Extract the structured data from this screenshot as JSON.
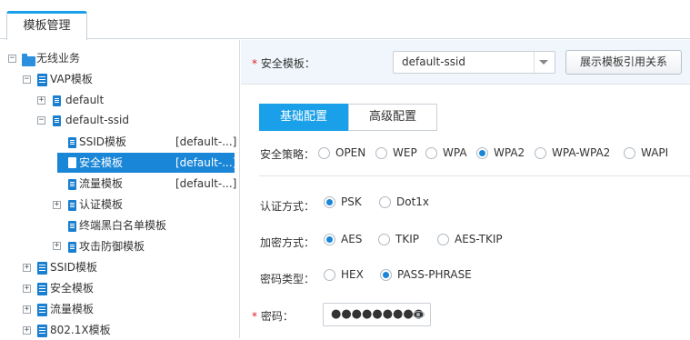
{
  "tabs": {
    "active": "模板管理"
  },
  "tree": {
    "root": "无线业务",
    "vap": "VAP模板",
    "default": "default",
    "default_ssid": "default-ssid",
    "ssid_tpl": {
      "label": "SSID模板",
      "value": "[default-...]"
    },
    "security_tpl": {
      "label": "安全模板",
      "value": "[default-...]"
    },
    "traffic_tpl": {
      "label": "流量模板",
      "value": "[default-...]"
    },
    "auth_tpl": "认证模板",
    "blacklist_tpl": "终端黑白名单模板",
    "attack_tpl": "攻击防御模板",
    "top_ssid": "SSID模板",
    "top_security": "安全模板",
    "top_traffic": "流量模板",
    "top_8021x": "802.1X模板"
  },
  "header": {
    "label": "安全模板：",
    "selected": "default-ssid",
    "button": "展示模板引用关系"
  },
  "subtabs": {
    "basic": "基础配置",
    "advanced": "高级配置"
  },
  "policy": {
    "label": "安全策略：",
    "options": [
      "OPEN",
      "WEP",
      "WPA",
      "WPA2",
      "WPA-WPA2",
      "WAPI"
    ],
    "selected": "WPA2"
  },
  "auth": {
    "label": "认证方式：",
    "options": [
      "PSK",
      "Dot1x"
    ],
    "selected": "PSK"
  },
  "enc": {
    "label": "加密方式：",
    "options": [
      "AES",
      "TKIP",
      "AES-TKIP"
    ],
    "selected": "AES"
  },
  "pwtype": {
    "label": "密码类型：",
    "options": [
      "HEX",
      "PASS-PHRASE"
    ],
    "selected": "PASS-PHRASE"
  },
  "password": {
    "label": "密码：",
    "masked": "●●●●●●●●●"
  },
  "colors": {
    "accent": "#1aa0e8",
    "selection": "#1a86d8",
    "header_bg": "#f0f6fc"
  },
  "icons": [
    "folder-icon",
    "document-icon",
    "eye-icon",
    "chevron-down-icon"
  ]
}
